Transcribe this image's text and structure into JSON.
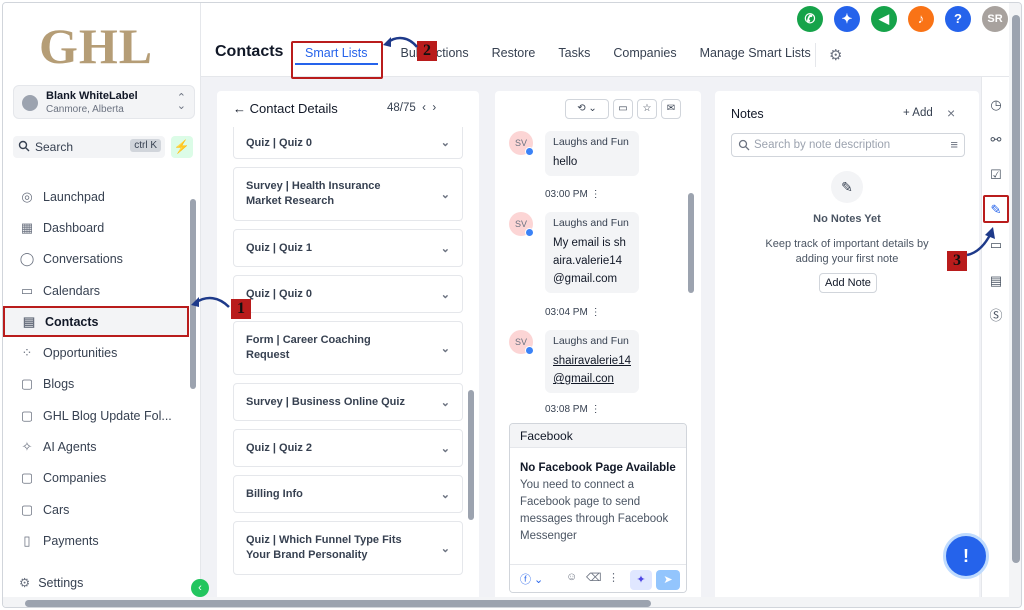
{
  "logo": "GHL",
  "account": {
    "name": "Blank WhiteLabel",
    "location": "Canmore, Alberta"
  },
  "search": {
    "label": "Search",
    "shortcut": "ctrl K"
  },
  "nav": [
    {
      "label": "Launchpad",
      "icon": "rocket-icon"
    },
    {
      "label": "Dashboard",
      "icon": "grid-icon"
    },
    {
      "label": "Conversations",
      "icon": "chat-icon"
    },
    {
      "label": "Calendars",
      "icon": "calendar-icon"
    },
    {
      "label": "Contacts",
      "icon": "contacts-icon",
      "active": true
    },
    {
      "label": "Opportunities",
      "icon": "opportunities-icon"
    },
    {
      "label": "Blogs",
      "icon": "blog-icon"
    },
    {
      "label": "GHL Blog Update Fol...",
      "icon": "folder-icon"
    },
    {
      "label": "AI Agents",
      "icon": "sparkle-icon"
    },
    {
      "label": "Companies",
      "icon": "building-icon"
    },
    {
      "label": "Cars",
      "icon": "box-icon"
    },
    {
      "label": "Payments",
      "icon": "payments-icon"
    }
  ],
  "settings_label": "Settings",
  "header": {
    "title": "Contacts",
    "tabs": [
      "Smart Lists",
      "Bulk Actions",
      "Restore",
      "Tasks",
      "Companies",
      "Manage Smart Lists"
    ],
    "user_initials": "SR"
  },
  "contact_details": {
    "title": "Contact Details",
    "count": "48/75",
    "items": [
      "Quiz | Quiz 0",
      "Survey | Health Insurance Market Research",
      "Quiz | Quiz 1",
      "Quiz | Quiz 0",
      "Form | Career Coaching Request",
      "Survey | Business Online Quiz",
      "Quiz | Quiz 2",
      "Billing Info",
      "Quiz | Which Funnel Type Fits Your Brand Personality"
    ]
  },
  "messages": [
    {
      "avatar": "SV",
      "sender": "Laughs and Fun",
      "text": "hello",
      "time": "03:00 PM",
      "link": false
    },
    {
      "avatar": "SV",
      "sender": "Laughs and Fun",
      "text": "My email is shaira.valerie14@gmail.com",
      "time": "03:04 PM",
      "link": false
    },
    {
      "avatar": "SV",
      "sender": "Laughs and Fun",
      "text": "shairavalerie14@gmail.con",
      "time": "03:08 PM",
      "link": true
    }
  ],
  "facebook": {
    "header": "Facebook",
    "title": "No Facebook Page Available",
    "description": "You need to connect a Facebook page to send messages through Facebook Messenger"
  },
  "notes": {
    "title": "Notes",
    "add_label": "+ Add",
    "search_placeholder": "Search by note description",
    "empty_title": "No Notes Yet",
    "empty_desc": "Keep track of important details by adding your first note",
    "add_button": "Add Note"
  },
  "annotations": [
    "1",
    "2",
    "3"
  ],
  "colors": {
    "highlight": "#b91c1c",
    "active_tab": "#2563eb",
    "logo": "#b59d76"
  }
}
